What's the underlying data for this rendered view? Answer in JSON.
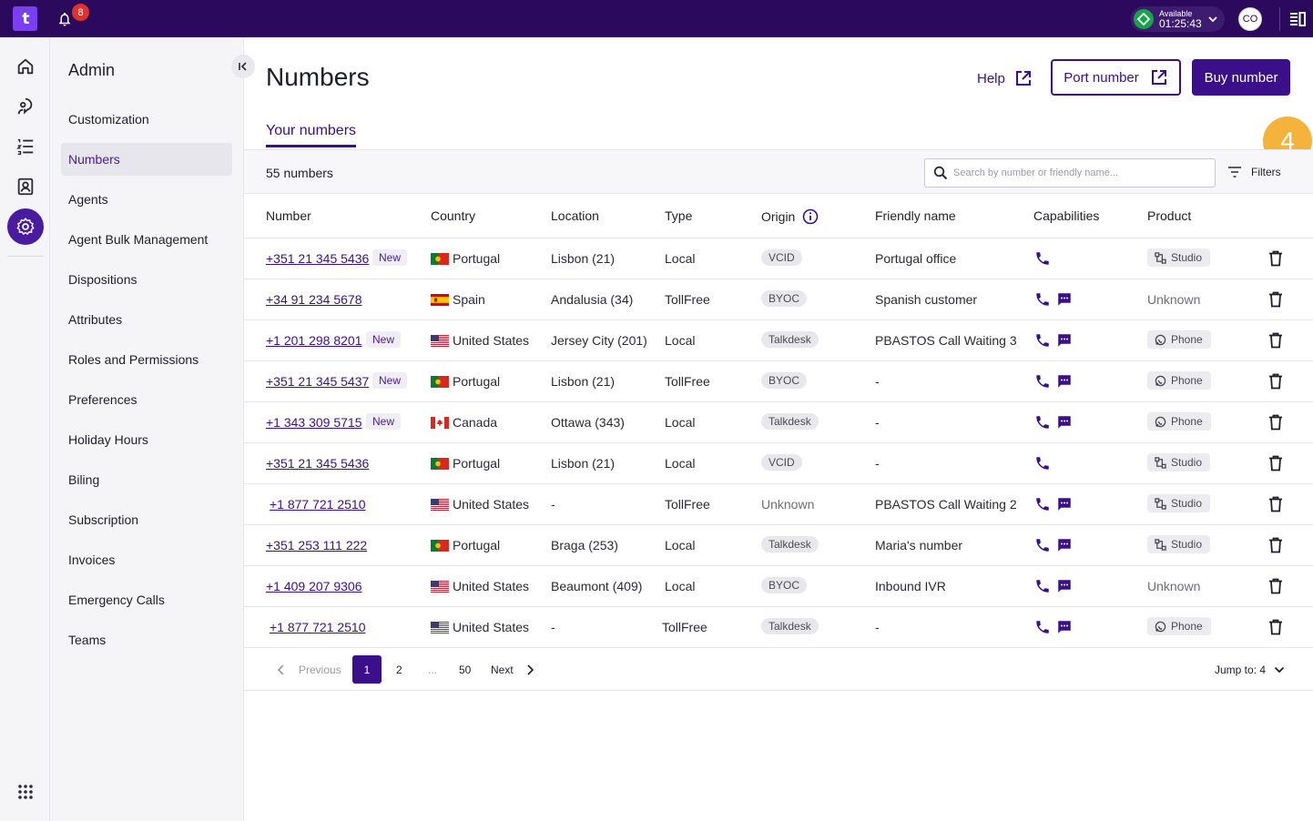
{
  "topbar": {
    "logo_text": "t",
    "notification_count": "8",
    "status_label": "Available",
    "status_time": "01:25:43",
    "avatar_initials": "CO"
  },
  "rail": {
    "icons": [
      "home-icon",
      "conversations-icon",
      "list-icon",
      "contacts-icon",
      "settings-icon",
      "apps-grid-icon"
    ]
  },
  "sidebar": {
    "title": "Admin",
    "items": [
      {
        "label": "Customization"
      },
      {
        "label": "Numbers"
      },
      {
        "label": "Agents"
      },
      {
        "label": "Agent Bulk Management"
      },
      {
        "label": "Dispositions"
      },
      {
        "label": "Attributes"
      },
      {
        "label": "Roles and Permissions"
      },
      {
        "label": "Preferences"
      },
      {
        "label": "Holiday Hours"
      },
      {
        "label": "Biling"
      },
      {
        "label": "Subscription"
      },
      {
        "label": "Invoices"
      },
      {
        "label": "Emergency Calls"
      },
      {
        "label": "Teams"
      }
    ]
  },
  "header": {
    "title": "Numbers",
    "help_label": "Help",
    "port_label": "Port number",
    "buy_label": "Buy number",
    "tab_label": "Your numbers"
  },
  "toolbar": {
    "count_label": "55 numbers",
    "search_placeholder": "Search by number or friendly name...",
    "filters_label": "Filters",
    "step_marker": "4"
  },
  "table": {
    "columns": [
      "Number",
      "Country",
      "Location",
      "Type",
      "Origin",
      "Friendly name",
      "Capabilities",
      "Product"
    ],
    "new_label": "New",
    "rows": [
      {
        "number": "+351 21 345 5436",
        "new": true,
        "country": "Portugal",
        "flag": "pt",
        "location": "Lisbon (21)",
        "type": "Local",
        "origin": "VCID",
        "origin_pill": true,
        "friendly": "Portugal office",
        "sms": false,
        "product": "Studio",
        "product_pill": true
      },
      {
        "number": "+34 91 234 5678",
        "new": false,
        "country": "Spain",
        "flag": "es",
        "location": "Andalusia (34)",
        "type": "TollFree",
        "origin": "BYOC",
        "origin_pill": true,
        "friendly": "Spanish customer",
        "sms": true,
        "product": "Unknown",
        "product_pill": false
      },
      {
        "number": "+1 201 298 8201",
        "new": true,
        "country": "United States",
        "flag": "us",
        "location": "Jersey City (201)",
        "type": "Local",
        "origin": "Talkdesk",
        "origin_pill": true,
        "friendly": "PBASTOS Call Waiting 3",
        "sms": true,
        "product": "Phone",
        "product_pill": true
      },
      {
        "number": "+351 21 345 5437",
        "new": true,
        "country": "Portugal",
        "flag": "pt",
        "location": "Lisbon (21)",
        "type": "TollFree",
        "origin": "BYOC",
        "origin_pill": true,
        "friendly": "-",
        "sms": true,
        "product": "Phone",
        "product_pill": true
      },
      {
        "number": "+1 343 309 5715",
        "new": true,
        "country": "Canada",
        "flag": "ca",
        "location": "Ottawa (343)",
        "type": "Local",
        "origin": "Talkdesk",
        "origin_pill": true,
        "friendly": "-",
        "sms": true,
        "product": "Phone",
        "product_pill": true
      },
      {
        "number": "+351 21 345 5436",
        "new": false,
        "country": "Portugal",
        "flag": "pt",
        "location": "Lisbon (21)",
        "type": "Local",
        "origin": "VCID",
        "origin_pill": true,
        "friendly": "-",
        "sms": false,
        "product": "Studio",
        "product_pill": true
      },
      {
        "number": "+1 877 721 2510",
        "new": false,
        "country": "United States",
        "flag": "us",
        "location": "-",
        "type": "TollFree",
        "origin": "Unknown",
        "origin_pill": false,
        "friendly": "PBASTOS Call Waiting 2",
        "sms": true,
        "product": "Studio",
        "product_pill": true
      },
      {
        "number": "+351 253 111 222",
        "new": false,
        "country": "Portugal",
        "flag": "pt",
        "location": "Braga (253)",
        "type": "Local",
        "origin": "Talkdesk",
        "origin_pill": true,
        "friendly": "Maria's number",
        "sms": true,
        "product": "Studio",
        "product_pill": true
      },
      {
        "number": "+1 409 207 9306",
        "new": false,
        "country": "United States",
        "flag": "us",
        "location": "Beaumont (409)",
        "type": "Local",
        "origin": "BYOC",
        "origin_pill": true,
        "friendly": "Inbound IVR",
        "sms": true,
        "product": "Unknown",
        "product_pill": false
      },
      {
        "number": "+1 877 721 2510",
        "new": false,
        "country": "United States",
        "flag": "us",
        "location": "-",
        "type": "TollFree",
        "origin": "Talkdesk",
        "origin_pill": true,
        "friendly": "-",
        "sms": true,
        "product": "Phone",
        "product_pill": true
      }
    ]
  },
  "pagination": {
    "previous_label": "Previous",
    "pages": [
      "1",
      "2",
      "...",
      "50"
    ],
    "current_page": "1",
    "next_label": "Next",
    "jump_label": "Jump to: 4"
  },
  "colors": {
    "topbar": "#2b0a5e",
    "accent": "#3b0f8a",
    "status_green": "#17a34a",
    "badge_red": "#e0312a",
    "step_marker": "#f6b33b"
  }
}
